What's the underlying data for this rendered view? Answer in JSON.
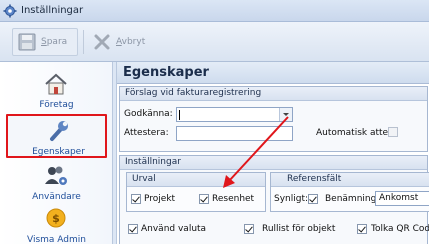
{
  "window": {
    "title": "Inställningar",
    "app_icon": "gear-icon"
  },
  "toolbar": {
    "save": {
      "label": "Spara",
      "mnemonic": "S",
      "rest": "para",
      "icon": "floppy-disk-icon"
    },
    "cancel": {
      "label": "Avbryt",
      "mnemonic": "A",
      "rest": "vbryt",
      "icon": "x-mark-icon"
    }
  },
  "sidebar": {
    "items": [
      {
        "label": "Företag",
        "icon": "house-icon",
        "active": false
      },
      {
        "label": "Egenskaper",
        "icon": "wrench-icon",
        "active": true
      },
      {
        "label": "Användare",
        "icon": "users-gear-icon",
        "active": false
      },
      {
        "label": "Visma Admin",
        "icon": "coins-icon",
        "active": false
      }
    ]
  },
  "page": {
    "title": "Egenskaper",
    "invoice_group": {
      "title": "Förslag vid fakturaregistrering",
      "approve_label": "Godkänna:",
      "approve_value": "",
      "attest_label": "Attestera:",
      "attest_value": "",
      "auto_attest_label": "Automatisk attest",
      "auto_attest_checked": false
    },
    "settings_group": {
      "title": "Inställningar",
      "selection": {
        "title": "Urval",
        "project_label": "Projekt",
        "project_checked": true,
        "travel_label": "Resenhet",
        "travel_checked": true
      },
      "reference": {
        "title": "Referensfält",
        "visible_label": "Synligt:",
        "visible_checked": true,
        "name_label": "Benämning:",
        "name_value": "Ankomst"
      },
      "use_currency_label": "Använd valuta",
      "use_currency_checked": true,
      "scroll_list_label": "Rullist för objekt",
      "scroll_list_checked": true,
      "qr_label": "Tolka QR Code",
      "qr_checked": true
    }
  },
  "colors": {
    "highlight_box": "#e0161b",
    "annotation_arrow": "#e0161b",
    "nav_text": "#1f4e9a"
  }
}
